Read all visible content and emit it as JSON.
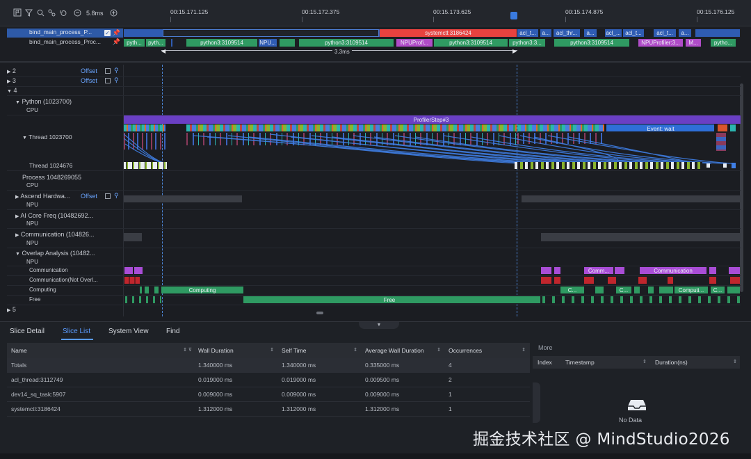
{
  "toolbar": {
    "zoom": "5.8ms",
    "icons": [
      "flag-icon",
      "filter-icon",
      "search-icon",
      "link-icon",
      "undo-icon",
      "zoom-out-icon",
      "zoom-in-icon"
    ]
  },
  "time_axis": {
    "ticks": [
      "00:15.171.125",
      "00:15.172.375",
      "00:15.173.625",
      "00:15.174.875",
      "00:15.176.125"
    ]
  },
  "pinned": {
    "row1": "bind_main_process_P...",
    "row2": "bind_main_process_Proc...",
    "measure": "3.3ms",
    "row1_slices": [
      "systemctl:3186424",
      "acl_t...",
      "a...",
      "acl_thr...",
      "a...",
      "acl_...",
      "acl_t...",
      "acl_t...",
      "a..."
    ],
    "row2_slices": [
      "pyth...",
      "pyth...",
      "python3:3109514",
      "NPU...",
      "python3:3109514",
      "NPUProfi...",
      "python3:3109514",
      "python3:3...",
      "python3:3109514",
      "NPUProfiler:3...",
      "M...",
      "pytho..."
    ]
  },
  "tracks": {
    "group2": "2",
    "group3": "3",
    "group4": "4",
    "group5": "5",
    "offset": "Offset",
    "python_proc": "Python (1023700)",
    "cpu": "CPU",
    "npu": "NPU",
    "thread1": "Thread 1023700",
    "thread2": "Thread 1024676",
    "process2": "Process 1048269055",
    "ascend": "Ascend Hardwa...",
    "aicore": "AI Core Freq (10482692...",
    "comm": "Communication (104826...",
    "overlap": "Overlap Analysis (10482...",
    "sub_comm": "Communication",
    "sub_comm_no": "Communication(Not Overl...",
    "sub_computing": "Computing",
    "sub_free": "Free",
    "profiler_step": "ProfilerStep#3",
    "event_wait": "Event: wait",
    "slice_comm1": "Comm...",
    "slice_comm2": "Communication",
    "slice_computing": "Computing",
    "slice_c1": "C...",
    "slice_c2": "C...",
    "slice_comput": "Computi...",
    "slice_c3": "C...",
    "slice_free": "Free"
  },
  "bottom": {
    "tabs": [
      "Slice Detail",
      "Slice List",
      "System View",
      "Find"
    ],
    "active_tab": "Slice List",
    "columns": [
      "Name",
      "Wall Duration",
      "Self Time",
      "Average Wall Duration",
      "Occurrences"
    ],
    "rows": [
      [
        "Totals",
        "1.340000 ms",
        "1.340000 ms",
        "0.335000 ms",
        "4"
      ],
      [
        "acl_thread:3112749",
        "0.019000 ms",
        "0.019000 ms",
        "0.009500 ms",
        "2"
      ],
      [
        "dev14_sq_task:5907",
        "0.009000 ms",
        "0.009000 ms",
        "0.009000 ms",
        "1"
      ],
      [
        "systemctl:3186424",
        "1.312000 ms",
        "1.312000 ms",
        "1.312000 ms",
        "1"
      ]
    ],
    "more": {
      "title": "More",
      "columns": [
        "Index",
        "Timestamp",
        "Duration(ns)"
      ],
      "empty": "No Data"
    }
  },
  "watermark": "掘金技术社区 @ MindStudio2026",
  "colors": {
    "accent": "#5b9cff",
    "selected_red": "#e8423f",
    "profiler_purple": "#6a3fc4",
    "wait_blue": "#2e6fd8",
    "computing_green": "#2f9a62",
    "comm_purple": "#a94dd6"
  }
}
